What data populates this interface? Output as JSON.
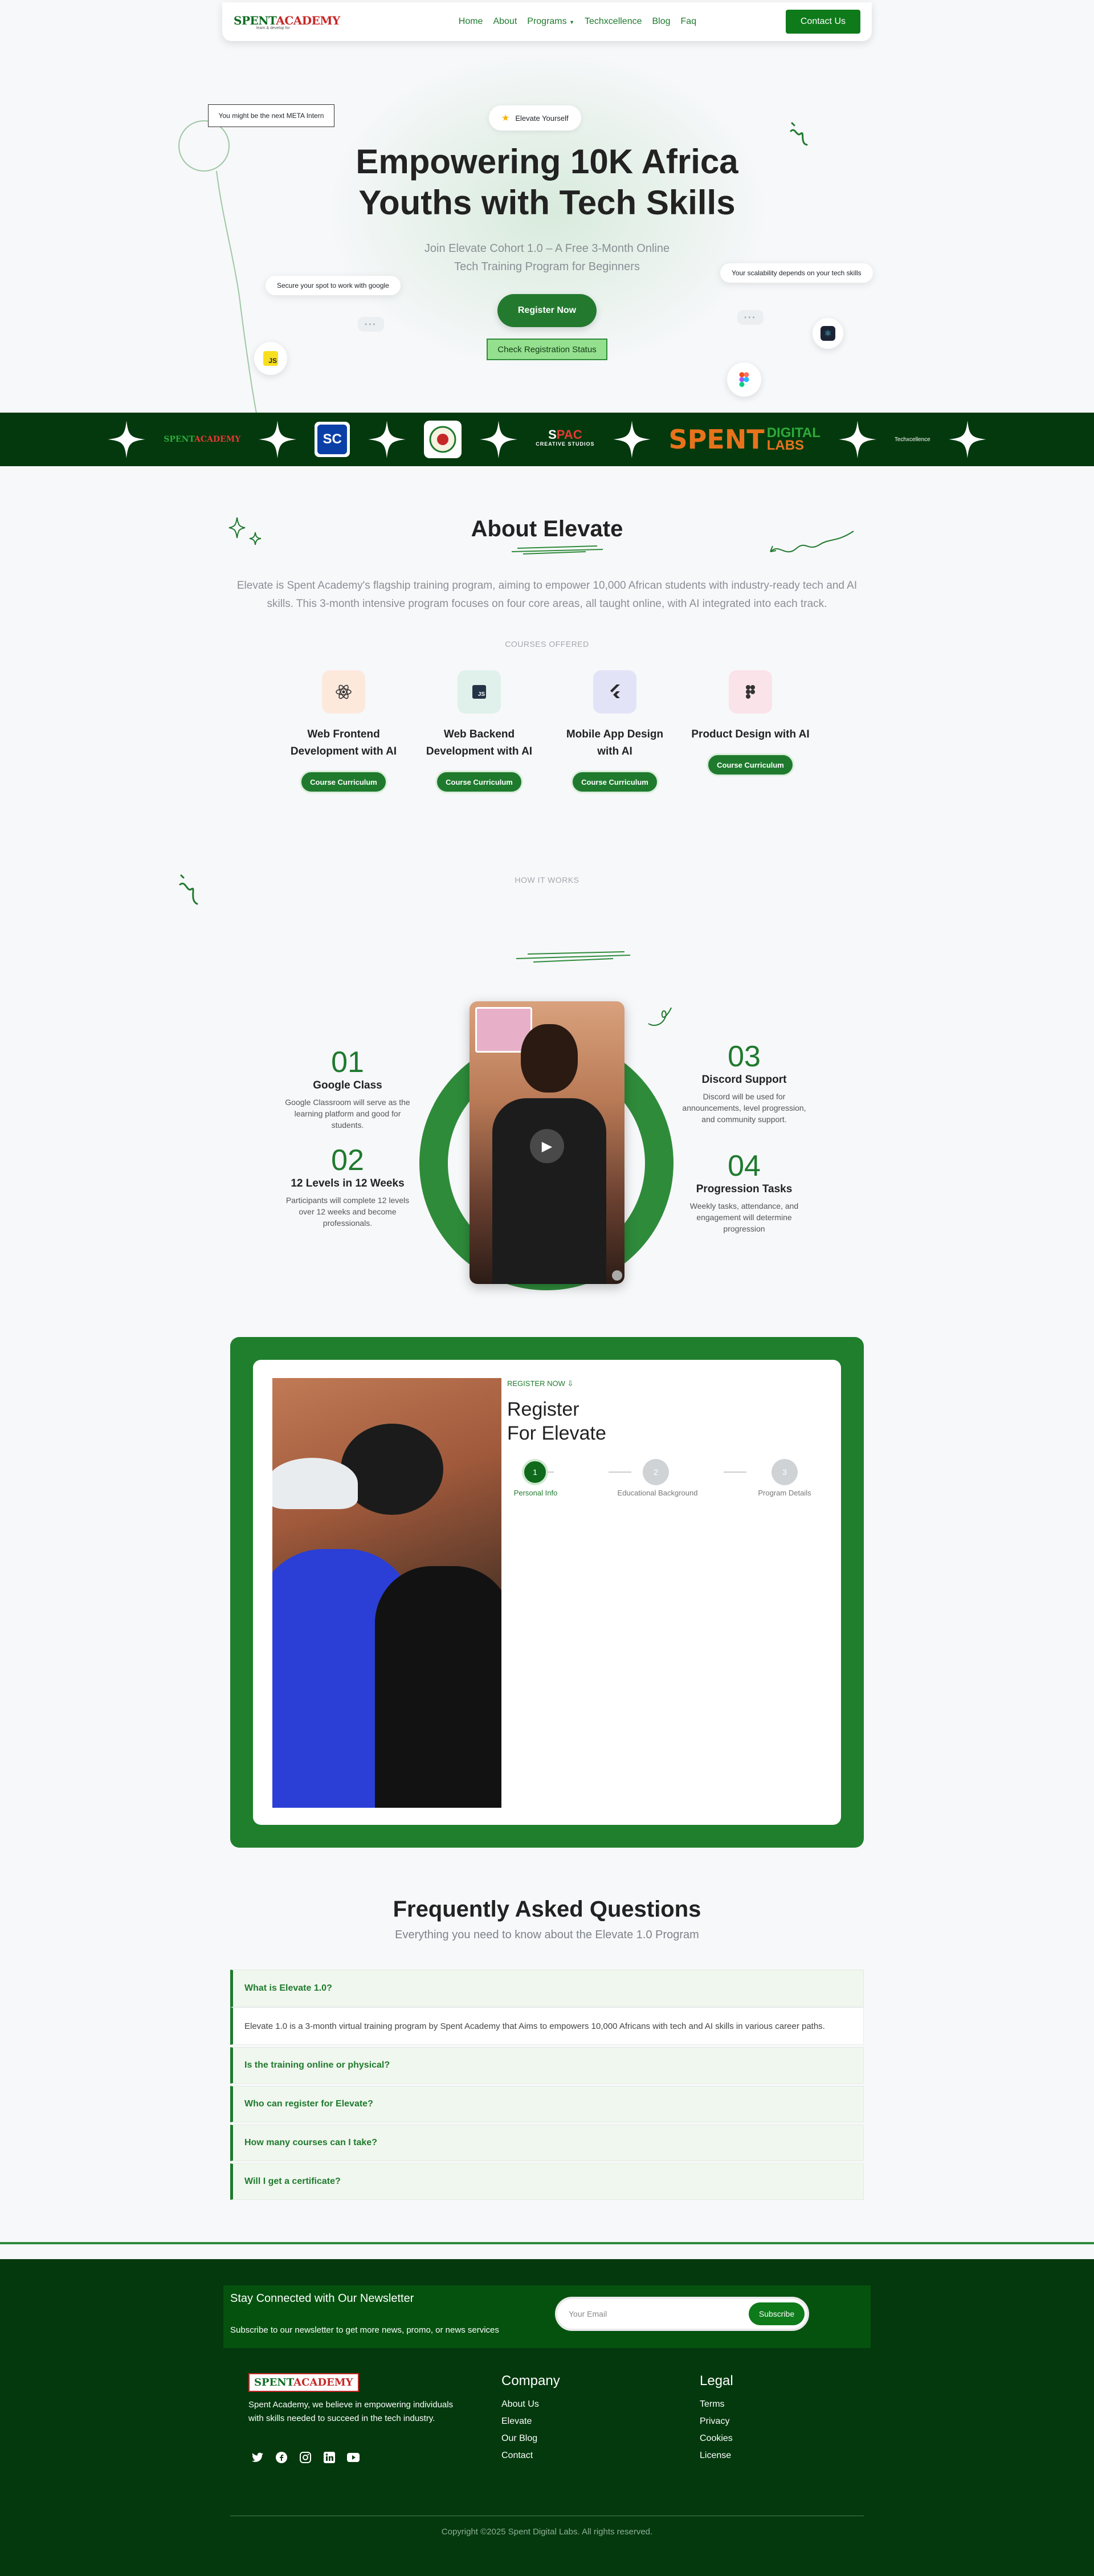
{
  "nav": {
    "logo_main": "SPENTACADEMY",
    "logo_sub": "learn & develop for",
    "links": [
      "Home",
      "About",
      "Programs",
      "Techxcellence",
      "Blog",
      "Faq"
    ],
    "contact": "Contact Us"
  },
  "hero": {
    "badge": "Elevate Yourself",
    "title_line1": "Empowering 10K Africa",
    "title_line2": "Youths with Tech Skills",
    "subtitle_line1": "Join Elevate Cohort 1.0 – A Free 3-Month Online",
    "subtitle_line2": "Tech Training Program for Beginners",
    "register": "Register Now",
    "check_status": "Check Registration Status",
    "intern_note": "You might be the next META Intern",
    "google_note": "Secure your spot to work with google",
    "scal_note": "Your scalability depends on your tech skills",
    "js_icon": "JS"
  },
  "band": {
    "logos": [
      "SPENTACADEMY",
      "SC",
      "seal",
      "SPAC CREATIVE STUDIOS",
      "SPENT DIGITAL LABS",
      "Techxcellence"
    ]
  },
  "about": {
    "title": "About Elevate",
    "text": "Elevate is Spent Academy's flagship training program, aiming to empower 10,000 African students with industry-ready tech and AI skills. This 3-month intensive program focuses on four core areas, all taught online, with AI integrated into each track.",
    "courses_label": "COURSES OFFERED",
    "courses": [
      {
        "title": "Web Frontend Development with AI",
        "button": "Course Curriculum",
        "icon": "react-icon"
      },
      {
        "title": "Web Backend Development with AI",
        "button": "Course Curriculum",
        "icon": "nodejs-icon"
      },
      {
        "title": "Mobile App Design with AI",
        "button": "Course Curriculum",
        "icon": "flutter-icon"
      },
      {
        "title": "Product Design with AI",
        "button": "Course Curriculum",
        "icon": "figma-icon"
      }
    ]
  },
  "how": {
    "label": "HOW IT WORKS",
    "steps": [
      {
        "num": "01",
        "title": "Google Class",
        "text": "Google Classroom will serve as the learning platform and good for students."
      },
      {
        "num": "02",
        "title": "12 Levels in 12 Weeks",
        "text": "Participants will complete 12 levels over 12 weeks and become professionals."
      },
      {
        "num": "03",
        "title": "Discord Support",
        "text": "Discord will be used for announcements, level progression, and community support."
      },
      {
        "num": "04",
        "title": "Progression Tasks",
        "text": "Weekly tasks, attendance, and engagement will determine progression"
      }
    ]
  },
  "register": {
    "eyebrow": "REGISTER NOW ⇩",
    "title_line1": "Register",
    "title_line2": "For Elevate",
    "steps": [
      {
        "num": "1",
        "label": "Personal Info"
      },
      {
        "num": "2",
        "label": "Educational Background"
      },
      {
        "num": "3",
        "label": "Program Details"
      }
    ]
  },
  "faq": {
    "title": "Frequently Asked Questions",
    "subtitle": "Everything you need to know about the Elevate 1.0 Program",
    "items": [
      {
        "q": "What is Elevate 1.0?",
        "a": "Elevate 1.0 is a 3-month virtual training program by Spent Academy that Aims to empowers 10,000 Africans with tech and AI skills in various career paths."
      },
      {
        "q": "Is the training online or physical?"
      },
      {
        "q": "Who can register for Elevate?"
      },
      {
        "q": "How many courses can I take?"
      },
      {
        "q": "Will I get a certificate?"
      }
    ]
  },
  "footer": {
    "news_title": "Stay Connected with Our Newsletter",
    "news_sub": "Subscribe to our newsletter to get more news, promo, or news services",
    "email_placeholder": "Your Email",
    "subscribe": "Subscribe",
    "about": "Spent Academy, we believe in empowering individuals with skills needed to succeed in the tech industry.",
    "company_title": "Company",
    "company_links": [
      "About Us",
      "Elevate",
      "Our Blog",
      "Contact"
    ],
    "legal_title": "Legal",
    "legal_links": [
      "Terms",
      "Privacy",
      "Cookies",
      "License"
    ],
    "copyright": "Copyright ©2025 Spent Digital Labs. All rights reserved.",
    "socials": [
      "twitter-icon",
      "facebook-icon",
      "instagram-icon",
      "linkedin-icon",
      "youtube-icon"
    ]
  },
  "colors": {
    "brand_green": "#1f7a2e",
    "dark_green": "#03390d",
    "accent_red": "#c62828"
  }
}
